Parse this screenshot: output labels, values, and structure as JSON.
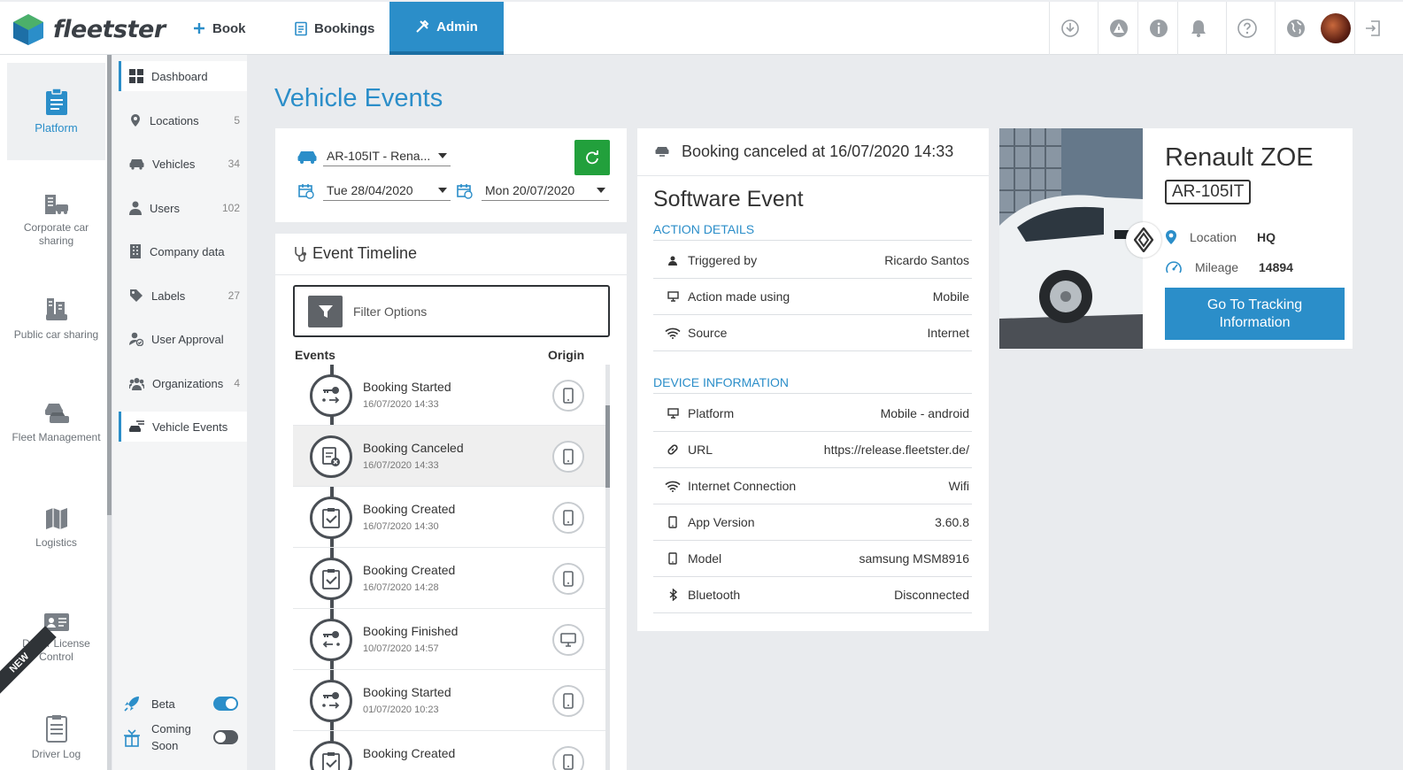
{
  "app": {
    "brand": "fleetster"
  },
  "nav": {
    "book": "Book",
    "bookings": "Bookings",
    "admin": "Admin"
  },
  "topbar_icons": [
    "download-icon",
    "warning-icon",
    "info-icon",
    "bell-icon",
    "help-icon",
    "globe-icon",
    "avatar",
    "logout-icon"
  ],
  "rail": [
    {
      "label": "Platform",
      "icon": "clipboard-icon"
    },
    {
      "label": "Corporate car sharing",
      "icon": "building-car-icon"
    },
    {
      "label": "Public car sharing",
      "icon": "city-car-icon"
    },
    {
      "label": "Fleet Management",
      "icon": "cars-icon"
    },
    {
      "label": "Logistics",
      "icon": "map-icon"
    },
    {
      "label": "Driver License Control",
      "icon": "id-card-icon",
      "badge": "NEW"
    },
    {
      "label": "Driver Log",
      "icon": "logbook-icon"
    }
  ],
  "submenu": [
    {
      "label": "Dashboard",
      "count": ""
    },
    {
      "label": "Locations",
      "count": "5"
    },
    {
      "label": "Vehicles",
      "count": "34"
    },
    {
      "label": "Users",
      "count": "102"
    },
    {
      "label": "Company data",
      "count": ""
    },
    {
      "label": "Labels",
      "count": "27"
    },
    {
      "label": "User Approval",
      "count": ""
    },
    {
      "label": "Organizations",
      "count": "4"
    },
    {
      "label": "Vehicle Events",
      "count": ""
    }
  ],
  "toggles": {
    "beta": "Beta",
    "coming_soon": "Coming Soon"
  },
  "page": {
    "title": "Vehicle Events"
  },
  "filters": {
    "vehicle": "AR-105IT - Rena...",
    "date_from": "Tue 28/04/2020",
    "date_to": "Mon 20/07/2020"
  },
  "timeline": {
    "title": "Event Timeline",
    "filter_label": "Filter Options",
    "col_events": "Events",
    "col_origin": "Origin",
    "events": [
      {
        "name": "Booking Started",
        "time": "16/07/2020 14:33",
        "origin": "mobile"
      },
      {
        "name": "Booking Canceled",
        "time": "16/07/2020 14:33",
        "origin": "mobile"
      },
      {
        "name": "Booking Created",
        "time": "16/07/2020 14:30",
        "origin": "mobile"
      },
      {
        "name": "Booking Created",
        "time": "16/07/2020 14:28",
        "origin": "mobile"
      },
      {
        "name": "Booking Finished",
        "time": "10/07/2020 14:57",
        "origin": "desktop"
      },
      {
        "name": "Booking Started",
        "time": "01/07/2020 10:23",
        "origin": "mobile"
      },
      {
        "name": "Booking Created",
        "time": "",
        "origin": "mobile"
      }
    ]
  },
  "detail": {
    "header": "Booking canceled at 16/07/2020 14:33",
    "title": "Software Event",
    "action_section": "ACTION DETAILS",
    "action_rows": [
      {
        "label": "Triggered by",
        "value": "Ricardo Santos"
      },
      {
        "label": "Action made using",
        "value": "Mobile"
      },
      {
        "label": "Source",
        "value": "Internet"
      }
    ],
    "device_section": "DEVICE INFORMATION",
    "device_rows": [
      {
        "label": "Platform",
        "value": "Mobile - android"
      },
      {
        "label": "URL",
        "value": "https://release.fleetster.de/"
      },
      {
        "label": "Internet Connection",
        "value": "Wifi"
      },
      {
        "label": "App Version",
        "value": "3.60.8"
      },
      {
        "label": "Model",
        "value": "samsung MSM8916"
      },
      {
        "label": "Bluetooth",
        "value": "Disconnected"
      }
    ]
  },
  "vehicle": {
    "name": "Renault ZOE",
    "plate": "AR-105IT",
    "location_label": "Location",
    "location": "HQ",
    "mileage_label": "Mileage",
    "mileage": "14894",
    "tracking_button": "Go To Tracking Information"
  },
  "colors": {
    "accent": "#2b8ec9",
    "refresh": "#22a03c",
    "dark": "#2f3337"
  }
}
